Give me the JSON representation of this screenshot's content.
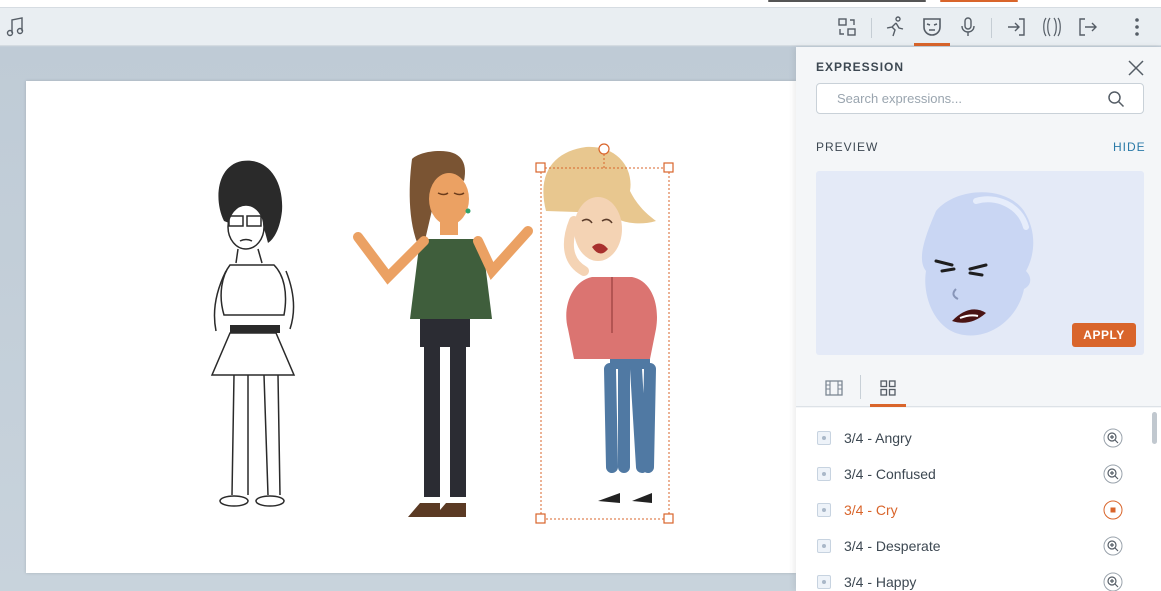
{
  "toolbar": {
    "buttons": [
      {
        "name": "music-icon"
      },
      {
        "name": "swap-icon"
      },
      {
        "name": "action-icon"
      },
      {
        "name": "expression-icon",
        "active": true
      },
      {
        "name": "microphone-icon"
      },
      {
        "name": "enter-icon"
      },
      {
        "name": "effects-icon"
      },
      {
        "name": "exit-icon"
      },
      {
        "name": "more-icon"
      }
    ]
  },
  "panel": {
    "title": "EXPRESSION",
    "search": {
      "placeholder": "Search expressions..."
    },
    "preview_label": "PREVIEW",
    "hide_label": "HIDE",
    "apply_label": "APPLY",
    "expressions": [
      {
        "label": "3/4 - Angry",
        "selected": false
      },
      {
        "label": "3/4 - Confused",
        "selected": false
      },
      {
        "label": "3/4 - Cry",
        "selected": true
      },
      {
        "label": "3/4 - Desperate",
        "selected": false
      },
      {
        "label": "3/4 - Happy",
        "selected": false
      }
    ]
  },
  "colors": {
    "accent": "#d9652b",
    "link": "#2a7aa8",
    "preview_bg": "#e4eaf7"
  }
}
